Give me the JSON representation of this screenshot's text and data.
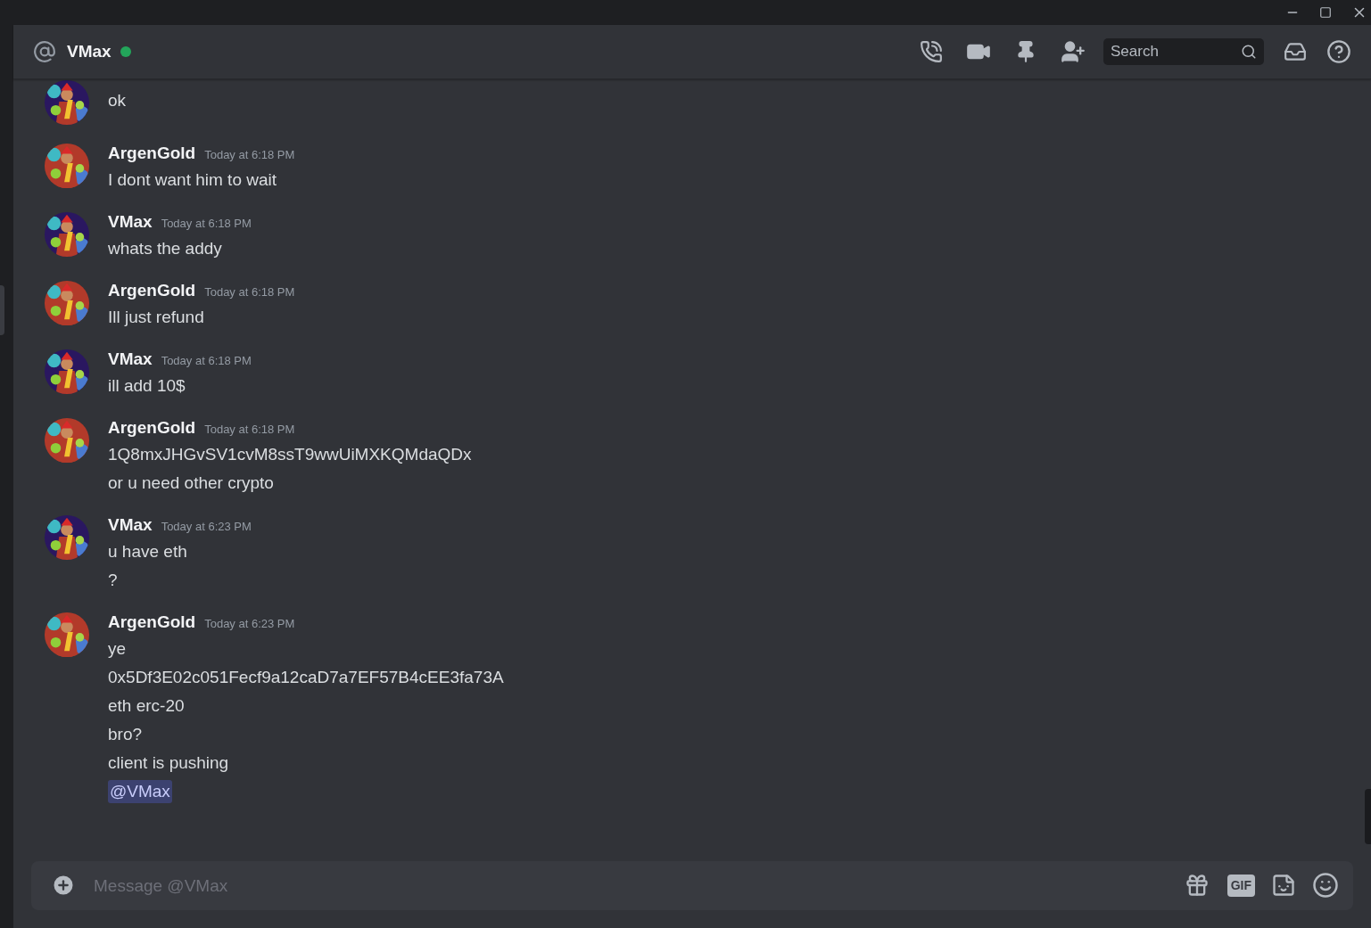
{
  "header": {
    "channel_name": "VMax",
    "online": true,
    "search": {
      "placeholder": "Search"
    }
  },
  "messages": [
    {
      "avatar": {
        "kind": "picture",
        "color": "#2a1760"
      },
      "lines": [
        {
          "kind": "text",
          "text": "ok"
        }
      ]
    },
    {
      "author": "ArgenGold",
      "avatar": {
        "kind": "picture",
        "color": "#b23a2a"
      },
      "time": "Today at 6:18 PM",
      "lines": [
        {
          "kind": "text",
          "text": "I dont want him to wait"
        }
      ]
    },
    {
      "author": "VMax",
      "avatar": {
        "kind": "picture",
        "color": "#2a1760"
      },
      "time": "Today at 6:18 PM",
      "lines": [
        {
          "kind": "text",
          "text": "whats the addy"
        }
      ]
    },
    {
      "author": "ArgenGold",
      "avatar": {
        "kind": "picture",
        "color": "#b23a2a"
      },
      "time": "Today at 6:18 PM",
      "lines": [
        {
          "kind": "text",
          "text": "Ill just refund"
        }
      ]
    },
    {
      "author": "VMax",
      "avatar": {
        "kind": "picture",
        "color": "#2a1760"
      },
      "time": "Today at 6:18 PM",
      "lines": [
        {
          "kind": "text",
          "text": "ill add 10$"
        }
      ]
    },
    {
      "author": "ArgenGold",
      "avatar": {
        "kind": "picture",
        "color": "#b23a2a"
      },
      "time": "Today at 6:18 PM",
      "lines": [
        {
          "kind": "text",
          "text": "1Q8mxJHGvSV1cvM8ssT9wwUiMXKQMdaQDx"
        },
        {
          "kind": "text",
          "text": "or u need other crypto"
        }
      ]
    },
    {
      "author": "VMax",
      "avatar": {
        "kind": "picture",
        "color": "#2a1760"
      },
      "time": "Today at 6:23 PM",
      "lines": [
        {
          "kind": "text",
          "text": "u have eth"
        },
        {
          "kind": "text",
          "text": "?"
        }
      ]
    },
    {
      "author": "ArgenGold",
      "avatar": {
        "kind": "picture",
        "color": "#b23a2a"
      },
      "time": "Today at 6:23 PM",
      "lines": [
        {
          "kind": "text",
          "text": "ye"
        },
        {
          "kind": "text",
          "text": "0x5Df3E02c051Fecf9a12caD7a7EF57B4cEE3fa73A"
        },
        {
          "kind": "text",
          "text": "eth erc-20"
        },
        {
          "kind": "text",
          "text": "bro?"
        },
        {
          "kind": "text",
          "text": "client is pushing"
        },
        {
          "kind": "mention",
          "text": "@VMax"
        }
      ]
    }
  ],
  "composer": {
    "placeholder": "Message @VMax",
    "gif_label": "GIF"
  }
}
